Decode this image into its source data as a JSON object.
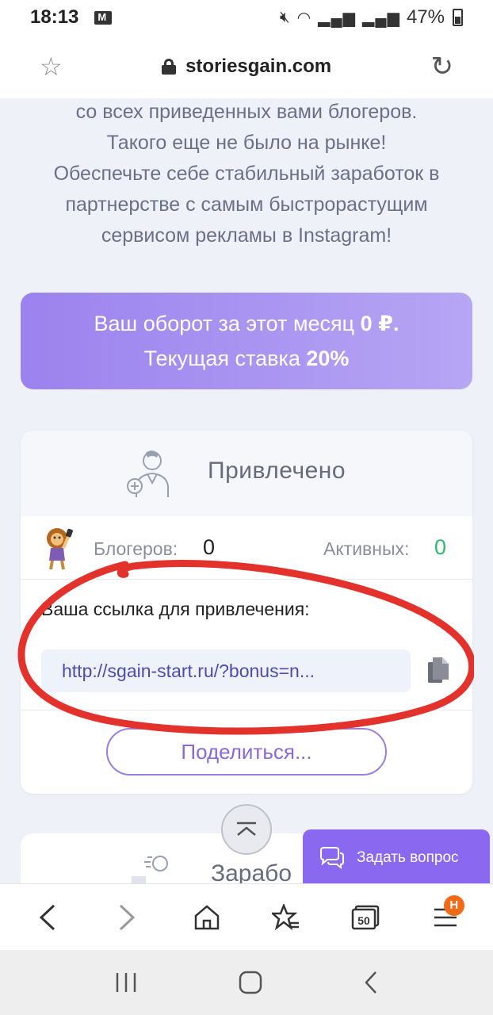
{
  "status_bar": {
    "time": "18:13",
    "battery": "47%"
  },
  "address_bar": {
    "url": "storiesgain.com"
  },
  "intro": {
    "lines": [
      "со всех приведенных вами блогеров.",
      "Такого еще не было на рынке!",
      "Обеспечьте себе стабильный заработок в",
      "партнерстве с самым быстрорастущим",
      "сервисом рекламы в Instagram!"
    ]
  },
  "turnover": {
    "line1_prefix": "Ваш оборот за этот месяц",
    "line1_value": "0 ₽.",
    "line2_prefix": "Текущая ставка",
    "line2_value": "20%"
  },
  "attracted_card": {
    "title": "Привлечено",
    "bloggers_label": "Блогеров:",
    "bloggers_value": "0",
    "active_label": "Активных:",
    "active_value": "0",
    "link_label": "Ваша ссылка для привлечения:",
    "link_value": "http://sgain-start.ru/?bonus=n...",
    "share_label": "Поделиться..."
  },
  "earnings_card": {
    "title": "Зарабо"
  },
  "chat": {
    "ask_label": "Задать вопрос"
  },
  "browser_nav": {
    "tabs_count": "50",
    "menu_badge": "H"
  },
  "colors": {
    "accent": "#8a68f0",
    "active_green": "#2eb872",
    "badge_orange": "#f06a17",
    "annotation_red": "#e3322c"
  }
}
